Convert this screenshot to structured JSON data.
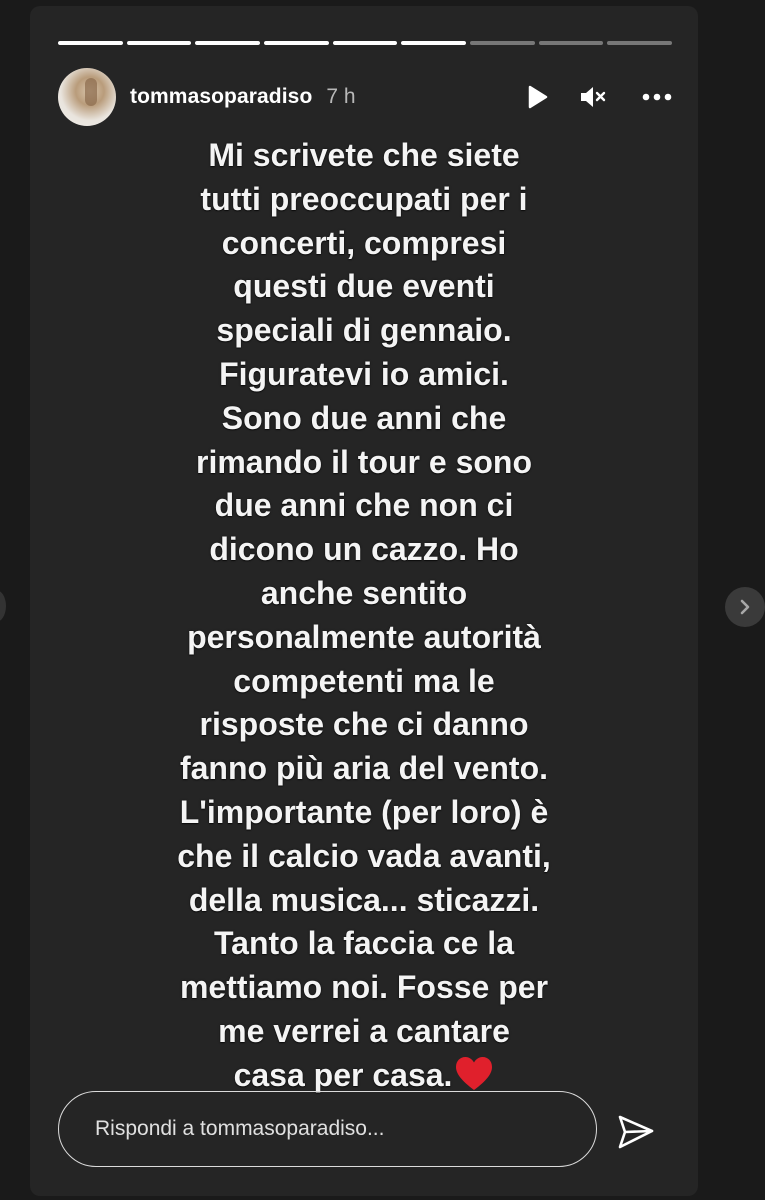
{
  "story": {
    "progress": {
      "total_segments": 9,
      "completed_segments": 6
    },
    "header": {
      "username": "tommasoparadiso",
      "time": "7 h",
      "avatar_icon": "user-avatar",
      "play_icon": "play-icon",
      "mute_icon": "speaker-muted-icon",
      "more_icon": "more-options-icon"
    },
    "text_lines": [
      "Mi scrivete che siete",
      "tutti preoccupati per i",
      "concerti, compresi",
      "questi due eventi",
      "speciali di gennaio.",
      "Figuratevi io amici.",
      "Sono due anni che",
      "rimando il tour e sono",
      "due anni che non ci",
      "dicono un cazzo. Ho",
      "anche sentito",
      "personalmente autorità",
      "competenti ma le",
      "risposte che ci danno",
      "fanno più aria del vento.",
      "L'importante (per loro) è",
      "che il calcio vada avanti,",
      "della musica... sticazzi.",
      "Tanto la faccia ce la",
      "mettiamo noi. Fosse per",
      "me verrei a cantare",
      "casa per casa."
    ],
    "emoji": "red-heart-emoji",
    "reply": {
      "placeholder": "Rispondi a tommasoparadiso..."
    },
    "send_icon": "send-paper-plane-icon",
    "next_icon": "chevron-right-icon"
  },
  "colors": {
    "background": "#1a1a1a",
    "story_background": "#252525",
    "text": "#f4f4f4",
    "heart": "#e0202c"
  }
}
